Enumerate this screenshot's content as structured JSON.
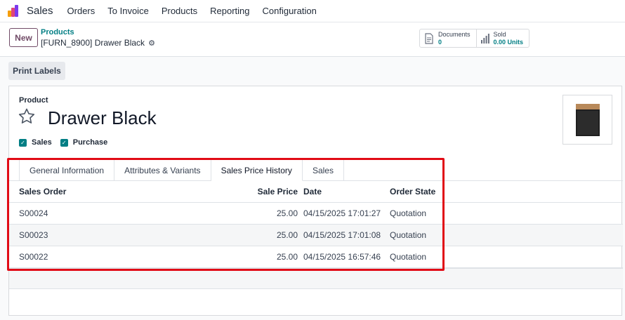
{
  "navbar": {
    "app_name": "Sales",
    "menu": [
      "Orders",
      "To Invoice",
      "Products",
      "Reporting",
      "Configuration"
    ]
  },
  "control": {
    "new_label": "New",
    "breadcrumb": "Products",
    "record_title": "[FURN_8900] Drawer Black",
    "stats": {
      "documents_label": "Documents",
      "documents_value": "0",
      "sold_label": "Sold",
      "sold_value": "0.00 Units"
    }
  },
  "actions": {
    "print_labels": "Print Labels"
  },
  "form": {
    "product_label": "Product",
    "product_name": "Drawer Black",
    "checkboxes": [
      {
        "label": "Sales",
        "checked": true
      },
      {
        "label": "Purchase",
        "checked": true
      }
    ],
    "tabs": [
      "General Information",
      "Attributes & Variants",
      "Sales Price History",
      "Sales"
    ],
    "active_tab": "Sales Price History",
    "table": {
      "headers": [
        "Sales Order",
        "Sale Price",
        "Date",
        "Order State"
      ],
      "rows": [
        [
          "S00024",
          "25.00",
          "04/15/2025 17:01:27",
          "Quotation"
        ],
        [
          "S00023",
          "25.00",
          "04/15/2025 17:01:08",
          "Quotation"
        ],
        [
          "S00022",
          "25.00",
          "04/15/2025 16:57:46",
          "Quotation"
        ]
      ]
    }
  },
  "colors": {
    "brand": "#714B67",
    "accent": "#017e84",
    "highlight": "#e10b16"
  }
}
